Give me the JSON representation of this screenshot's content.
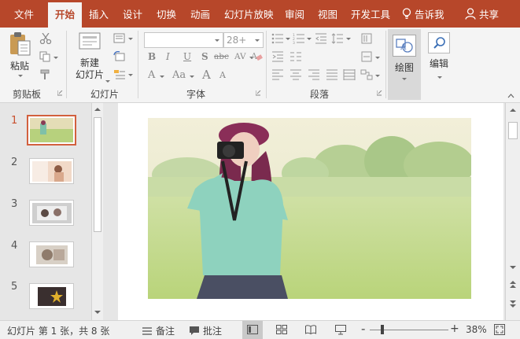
{
  "tabs": [
    {
      "label": "文件",
      "active": false
    },
    {
      "label": "开始",
      "active": true
    },
    {
      "label": "插入",
      "active": false
    },
    {
      "label": "设计",
      "active": false
    },
    {
      "label": "切换",
      "active": false
    },
    {
      "label": "动画",
      "active": false
    },
    {
      "label": "幻灯片放映",
      "active": false
    },
    {
      "label": "审阅",
      "active": false
    },
    {
      "label": "视图",
      "active": false
    },
    {
      "label": "开发工具",
      "active": false
    }
  ],
  "tell_me": "告诉我",
  "share": "共享",
  "ribbon": {
    "clipboard": {
      "paste_label": "粘贴",
      "group_label": "剪贴板"
    },
    "slides": {
      "new_slide_line1": "新建",
      "new_slide_line2": "幻灯片",
      "group_label": "幻灯片"
    },
    "font": {
      "font_name_value": "",
      "font_size_value": "28+",
      "group_label": "字体",
      "format_buttons": [
        "B",
        "I",
        "U",
        "S",
        "abc",
        "AV"
      ],
      "grow_font": "A",
      "shrink_font": "A",
      "change_case": "Aa"
    },
    "paragraph": {
      "group_label": "段落"
    },
    "drawing": {
      "label": "绘图"
    },
    "editing": {
      "label": "编辑"
    }
  },
  "thumbnails": [
    {
      "number": "1",
      "active": true
    },
    {
      "number": "2",
      "active": false
    },
    {
      "number": "3",
      "active": false
    },
    {
      "number": "4",
      "active": false
    },
    {
      "number": "5",
      "active": false
    }
  ],
  "status": {
    "slide_info": "幻灯片 第 1 张，共 8 张",
    "notes_label": "备注",
    "comments_label": "批注",
    "zoom_level": "38%",
    "zoom_fraction": 0.38
  },
  "colors": {
    "accent": "#b7472a",
    "thumb_active_border": "#d2603e"
  }
}
